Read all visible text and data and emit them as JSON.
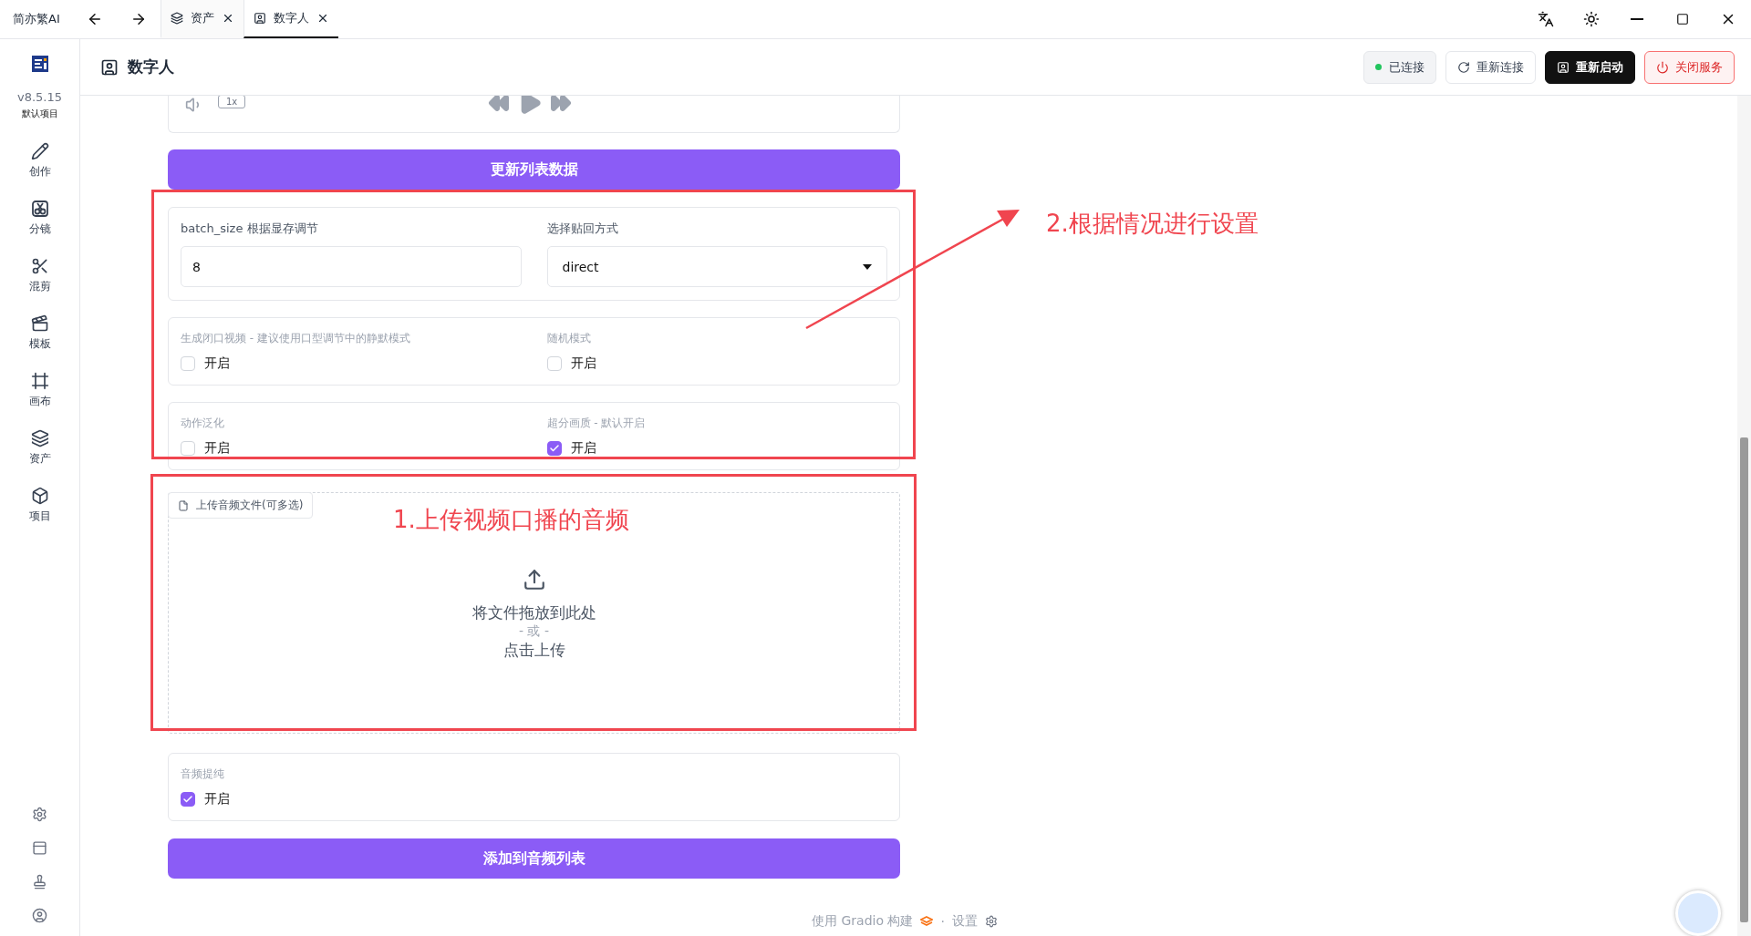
{
  "titlebar": {
    "app_name": "简亦繁AI",
    "tabs": [
      {
        "label": "资产",
        "selected": false
      },
      {
        "label": "数字人",
        "selected": true
      }
    ]
  },
  "sidebar": {
    "version": "v8.5.15",
    "project": "默认项目",
    "items": [
      {
        "label": "创作"
      },
      {
        "label": "分镜"
      },
      {
        "label": "混剪"
      },
      {
        "label": "模板"
      },
      {
        "label": "画布"
      },
      {
        "label": "资产"
      },
      {
        "label": "项目"
      }
    ]
  },
  "page": {
    "title": "数字人",
    "status": "已连接",
    "buttons": [
      {
        "label": "重新连接",
        "kind": "outline"
      },
      {
        "label": "重新启动",
        "kind": "dark"
      },
      {
        "label": "关闭服务",
        "kind": "danger"
      }
    ]
  },
  "player": {
    "speed": "1x"
  },
  "update_button": "更新列表数据",
  "fields": [
    {
      "label": "batch_size 根据显存调节",
      "kind": "input",
      "value": "8"
    },
    {
      "label": "选择贴回方式",
      "kind": "select",
      "value": "direct"
    }
  ],
  "toggle_rows": [
    [
      {
        "label": "生成闭口视频 - 建议使用口型调节中的静默模式",
        "option": "开启",
        "checked": false
      },
      {
        "label": "随机模式",
        "option": "开启",
        "checked": false
      }
    ],
    [
      {
        "label": "动作泛化",
        "option": "开启",
        "checked": false
      },
      {
        "label": "超分画质 - 默认开启",
        "option": "开启",
        "checked": true
      }
    ]
  ],
  "upload": {
    "label": "上传音频文件(可多选)",
    "drop_text": "将文件拖放到此处",
    "or_text": "- 或 -",
    "click_text": "点击上传"
  },
  "audio_purify": {
    "label": "音频提纯",
    "option": "开启",
    "checked": true
  },
  "add_button": "添加到音频列表",
  "footer": {
    "built_with": "使用 Gradio 构建",
    "separator": "·",
    "settings": "设置"
  },
  "annotations": [
    {
      "text": "2.根据情况进行设置"
    },
    {
      "text": "1.上传视频口播的音频"
    }
  ]
}
